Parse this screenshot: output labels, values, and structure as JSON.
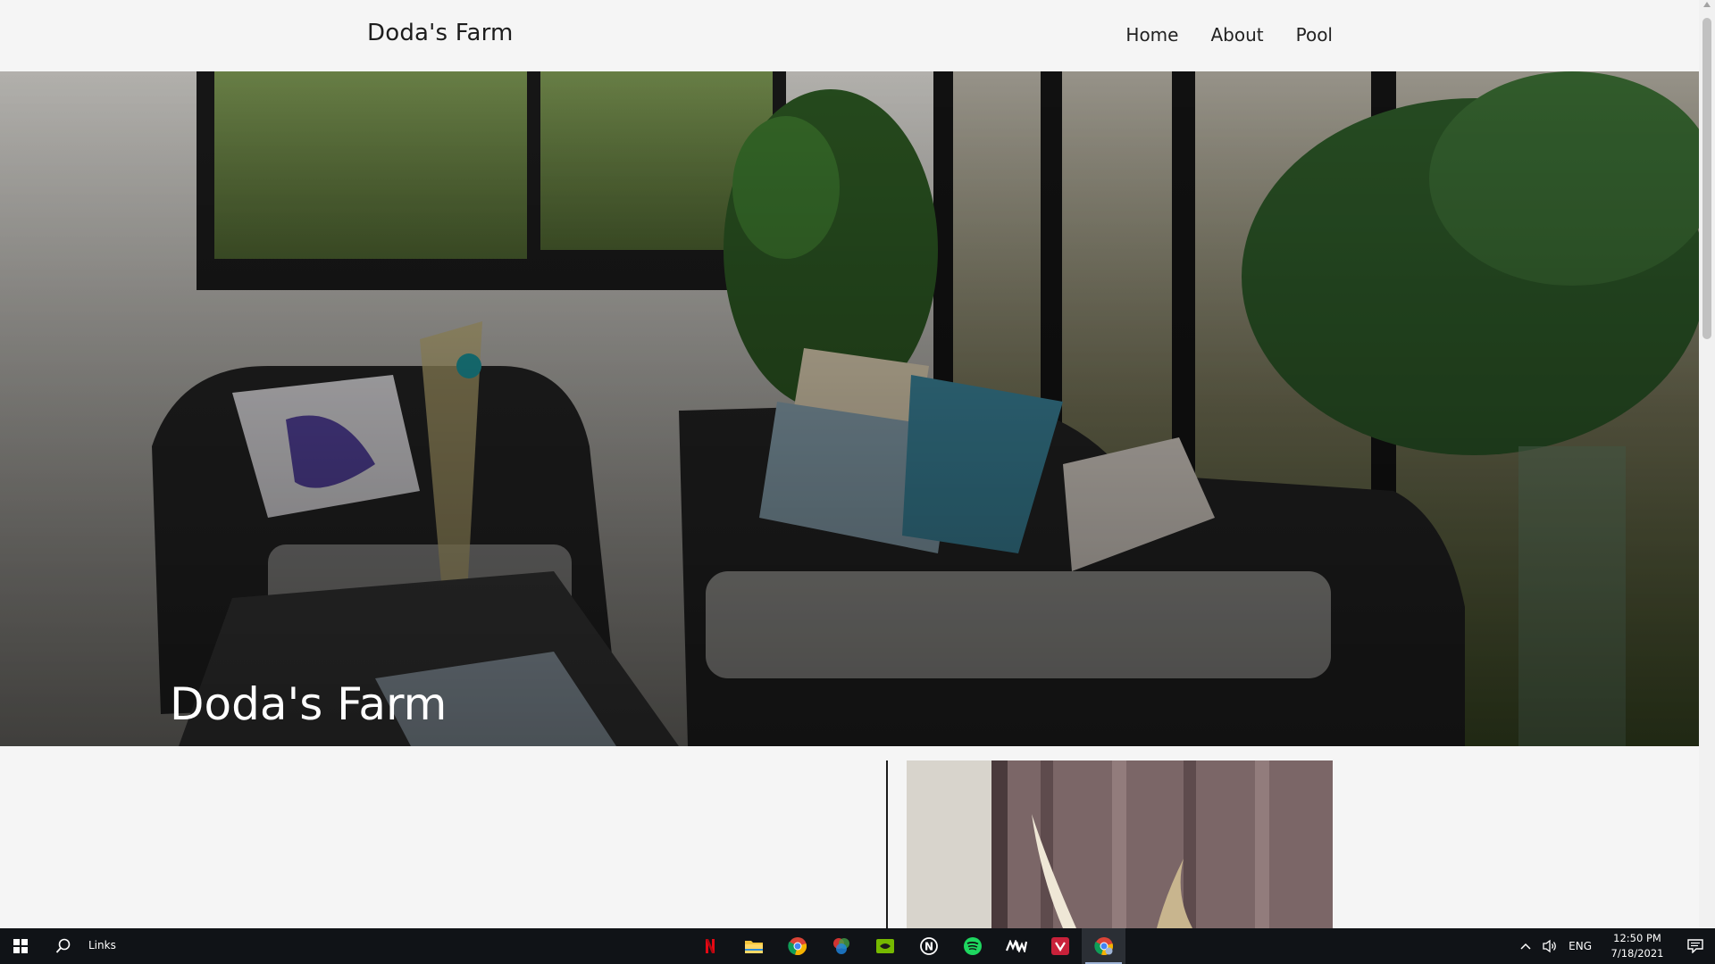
{
  "header": {
    "brand": "Doda's Farm",
    "nav": [
      {
        "label": "Home"
      },
      {
        "label": "About"
      },
      {
        "label": "Pool"
      }
    ]
  },
  "hero": {
    "title": "Doda's Farm"
  },
  "taskbar": {
    "search_text": "Links",
    "apps": [
      "netflix-icon",
      "file-explorer-icon",
      "chrome-icon",
      "color-picker-icon",
      "nvidia-icon",
      "notion-icon",
      "spotify-icon",
      "mw-icon",
      "vivaldi-icon",
      "chrome-profile-icon"
    ],
    "tray": {
      "language": "ENG",
      "time": "12:50 PM",
      "date": "7/18/2021"
    }
  },
  "colors": {
    "page_bg": "#f5f5f5",
    "taskbar_bg": "#101317",
    "hero_text": "#ffffff"
  }
}
